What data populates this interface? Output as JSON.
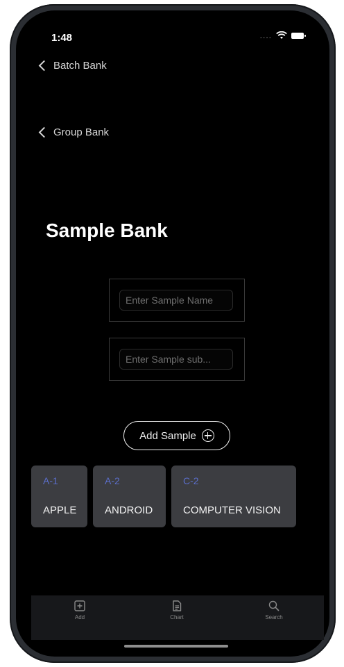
{
  "status_bar": {
    "time": "1:48",
    "signal_dots": "...."
  },
  "nav": {
    "back_batch": "Batch Bank",
    "back_group": "Group Bank"
  },
  "page": {
    "title": "Sample Bank"
  },
  "form": {
    "name_placeholder": "Enter Sample Name",
    "sub_placeholder": "Enter Sample sub..."
  },
  "add_button": {
    "label": "Add Sample"
  },
  "samples": [
    {
      "code": "A-1",
      "name": "APPLE"
    },
    {
      "code": "A-2",
      "name": "ANDROID"
    },
    {
      "code": "C-2",
      "name": "COMPUTER VISION"
    }
  ],
  "tabs": [
    {
      "label": "Add",
      "icon": "add-square-icon"
    },
    {
      "label": "Chart",
      "icon": "document-icon"
    },
    {
      "label": "Search",
      "icon": "search-icon"
    }
  ],
  "colors": {
    "chip_code": "#5b6ec9",
    "chip_bg": "#3c3d41",
    "background": "#000000"
  }
}
